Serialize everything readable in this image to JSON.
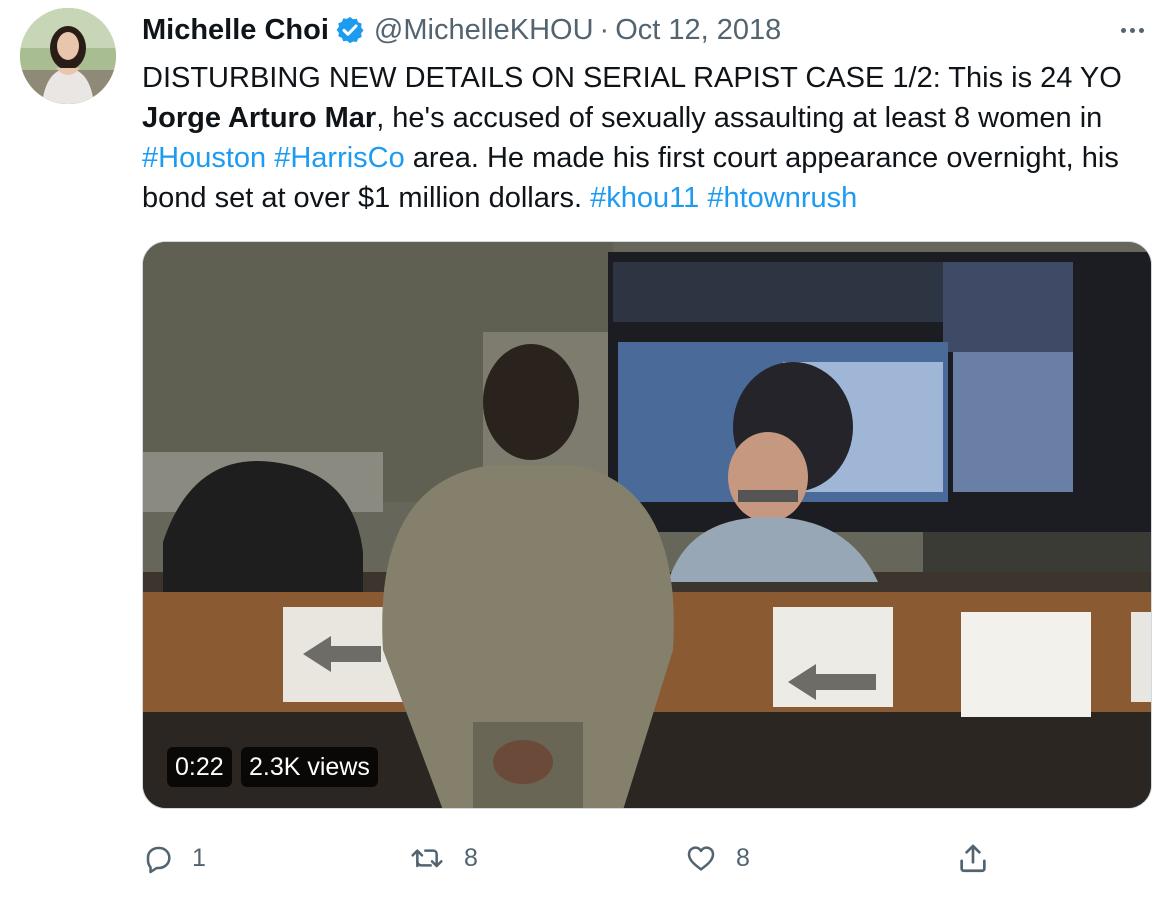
{
  "author": {
    "name": "Michelle Choi",
    "handle": "@MichelleKHOU",
    "separator": "·",
    "date": "Oct 12, 2018",
    "verified_icon": "verified-badge-icon",
    "verified_color": "#1d9bf0"
  },
  "tweet": {
    "segments": [
      {
        "text": "DISTURBING NEW DETAILS ON SERIAL RAPIST CASE 1/2: This is 24 YO ",
        "style": "plain"
      },
      {
        "text": "Jorge Arturo Mar",
        "style": "bold"
      },
      {
        "text": ", he's accused of sexually assaulting at least 8 women in ",
        "style": "plain"
      },
      {
        "text": "#Houston",
        "style": "hashtag"
      },
      {
        "text": " ",
        "style": "plain"
      },
      {
        "text": "#HarrisCo",
        "style": "hashtag"
      },
      {
        "text": " area. He made his first court appearance overnight, his bond set at over $1 million dollars. ",
        "style": "plain"
      },
      {
        "text": "#khou11",
        "style": "hashtag"
      },
      {
        "text": " ",
        "style": "plain"
      },
      {
        "text": "#htownrush",
        "style": "hashtag"
      }
    ]
  },
  "media": {
    "type": "video",
    "duration": "0:22",
    "views": "2.3K views"
  },
  "actions": {
    "reply_count": "1",
    "retweet_count": "8",
    "like_count": "8"
  },
  "colors": {
    "accent": "#1d9bf0",
    "text": "#0f1419",
    "muted": "#536471"
  }
}
